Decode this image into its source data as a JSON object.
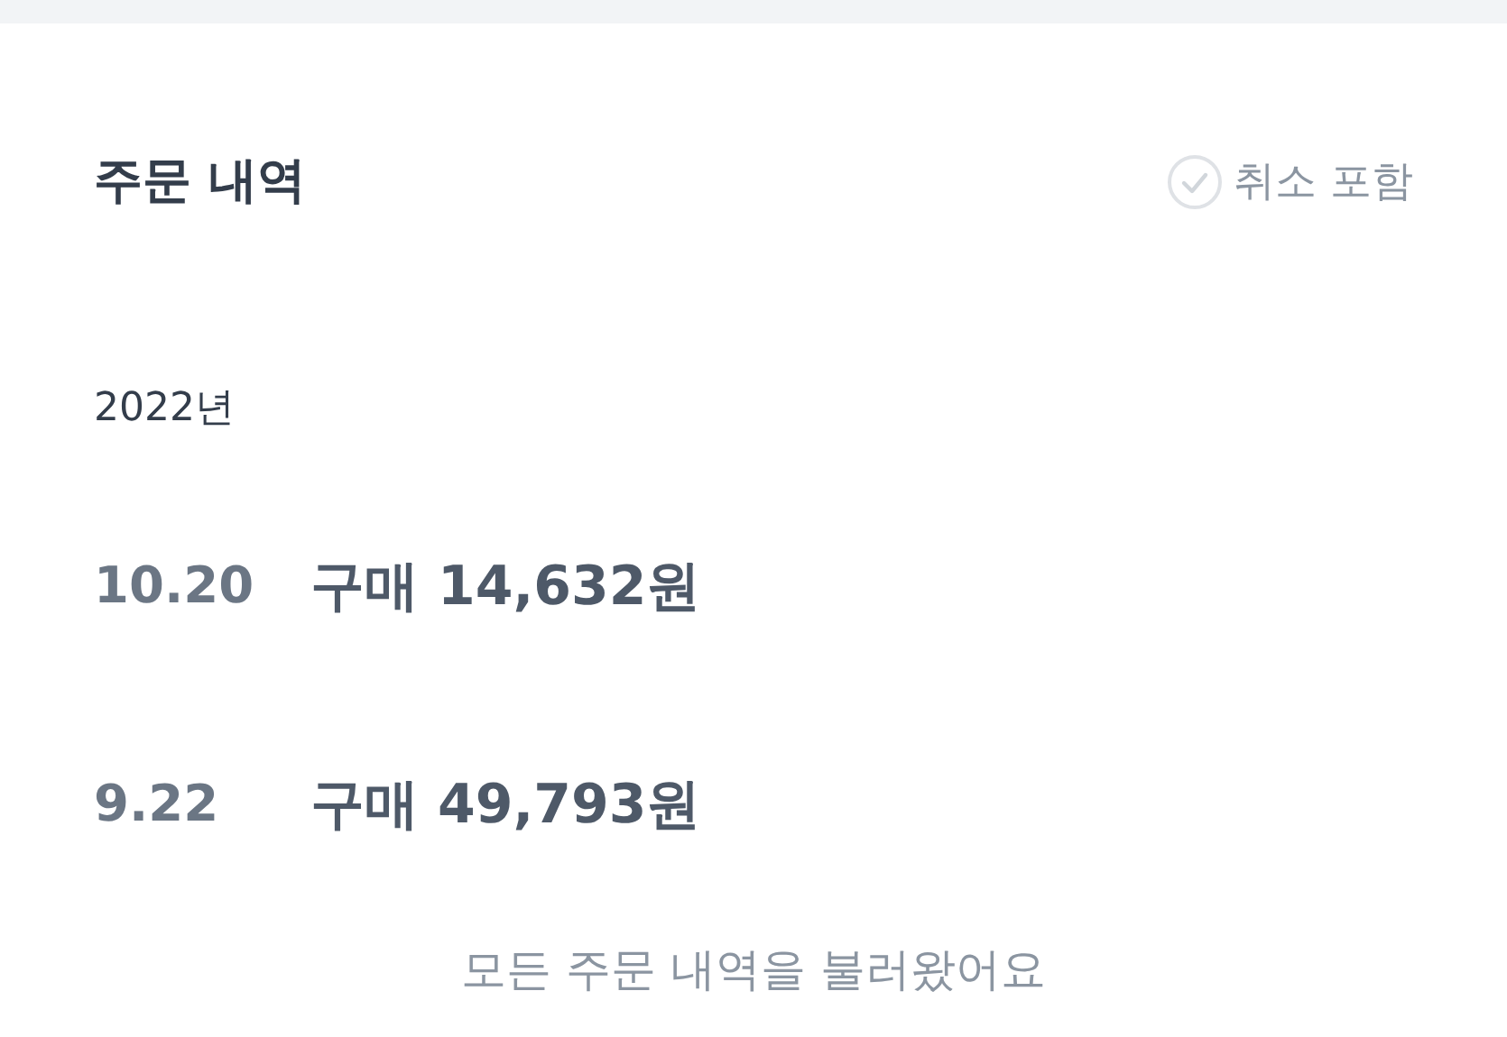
{
  "title": "주문 내역",
  "include_cancelled": {
    "label": "취소 포함",
    "checked": false
  },
  "year": "2022년",
  "orders": [
    {
      "date": "10.20",
      "summary": "구매 14,632원"
    },
    {
      "date": "9.22",
      "summary": "구매 49,793원"
    }
  ],
  "footer": "모든 주문 내역을 불러왔어요"
}
